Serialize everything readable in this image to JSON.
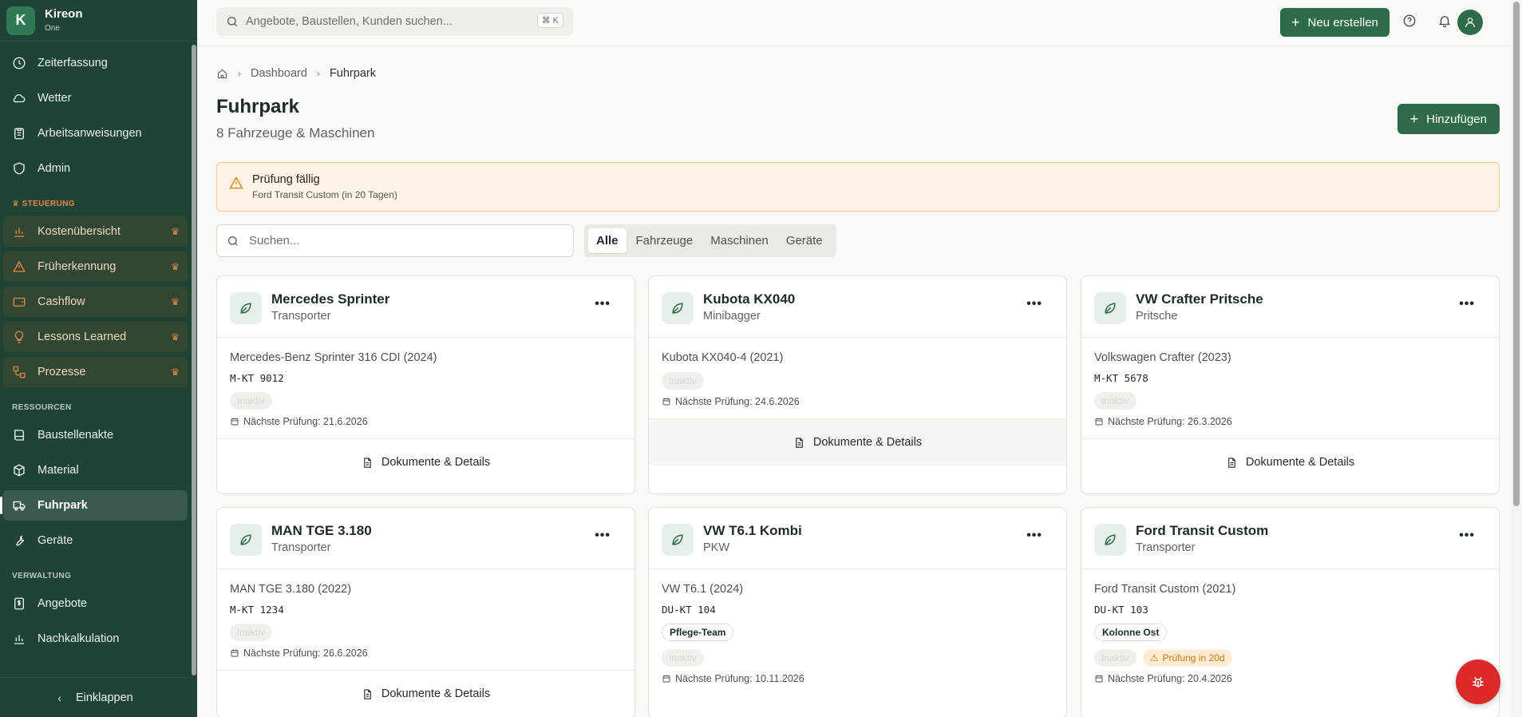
{
  "brand": {
    "initial": "K",
    "name": "Kireon",
    "sub": "One"
  },
  "sidebar": {
    "items_top": [
      {
        "label": "Zeiterfassung",
        "icon": "clock-icon"
      },
      {
        "label": "Wetter",
        "icon": "cloud-icon"
      },
      {
        "label": "Arbeitsanweisungen",
        "icon": "clipboard-icon"
      },
      {
        "label": "Admin",
        "icon": "shield-icon"
      }
    ],
    "section_steuerung": "STEUERUNG",
    "items_steuerung": [
      {
        "label": "Kostenübersicht",
        "icon": "bar-chart-icon"
      },
      {
        "label": "Früherkennung",
        "icon": "warning-icon"
      },
      {
        "label": "Cashflow",
        "icon": "wallet-icon"
      },
      {
        "label": "Lessons Learned",
        "icon": "lightbulb-icon"
      },
      {
        "label": "Prozesse",
        "icon": "workflow-icon"
      }
    ],
    "section_ressourcen": "RESSOURCEN",
    "items_ressourcen": [
      {
        "label": "Baustellenakte",
        "icon": "book-icon"
      },
      {
        "label": "Material",
        "icon": "package-icon"
      },
      {
        "label": "Fuhrpark",
        "icon": "truck-icon"
      },
      {
        "label": "Geräte",
        "icon": "wrench-icon"
      }
    ],
    "section_verwaltung": "VERWALTUNG",
    "items_verwaltung": [
      {
        "label": "Angebote",
        "icon": "dollar-doc-icon"
      },
      {
        "label": "Nachkalkulation",
        "icon": "bar-chart-icon"
      }
    ],
    "collapse_label": "Einklappen"
  },
  "topbar": {
    "search_placeholder": "Angebote, Baustellen, Kunden suchen...",
    "shortcut": "⌘ K",
    "new_label": "Neu erstellen"
  },
  "breadcrumb": {
    "parent": "Dashboard",
    "current": "Fuhrpark"
  },
  "page": {
    "title": "Fuhrpark",
    "subtitle": "8 Fahrzeuge & Maschinen",
    "add_label": "Hinzufügen"
  },
  "alert": {
    "title": "Prüfung fällig",
    "text": "Ford Transit Custom (in 20 Tagen)"
  },
  "filter": {
    "search_placeholder": "Suchen...",
    "tabs": [
      "Alle",
      "Fahrzeuge",
      "Maschinen",
      "Geräte"
    ],
    "active_tab": "Alle"
  },
  "cards": [
    {
      "title": "Mercedes Sprinter",
      "type": "Transporter",
      "model": "Mercedes-Benz Sprinter 316 CDI (2024)",
      "plate": "M-KT 9012",
      "team": "",
      "status": "Inaktiv",
      "due_badge": "",
      "next_check": "Nächste Prüfung: 21.6.2026",
      "footer": "Dokumente & Details"
    },
    {
      "title": "Kubota KX040",
      "type": "Minibagger",
      "model": "Kubota KX040-4 (2021)",
      "plate": "",
      "team": "",
      "status": "Inaktiv",
      "due_badge": "",
      "next_check": "Nächste Prüfung: 24.6.2026",
      "footer": "Dokumente & Details"
    },
    {
      "title": "VW Crafter Pritsche",
      "type": "Pritsche",
      "model": "Volkswagen Crafter (2023)",
      "plate": "M-KT 5678",
      "team": "",
      "status": "Inaktiv",
      "due_badge": "",
      "next_check": "Nächste Prüfung: 26.3.2026",
      "footer": "Dokumente & Details"
    },
    {
      "title": "MAN TGE 3.180",
      "type": "Transporter",
      "model": "MAN TGE 3.180 (2022)",
      "plate": "M-KT 1234",
      "team": "",
      "status": "Inaktiv",
      "due_badge": "",
      "next_check": "Nächste Prüfung: 26.6.2026",
      "footer": "Dokumente & Details"
    },
    {
      "title": "VW T6.1 Kombi",
      "type": "PKW",
      "model": "VW T6.1 (2024)",
      "plate": "DU-KT 104",
      "team": "Pflege-Team",
      "status": "Inaktiv",
      "due_badge": "",
      "next_check": "Nächste Prüfung: 10.11.2026",
      "footer": ""
    },
    {
      "title": "Ford Transit Custom",
      "type": "Transporter",
      "model": "Ford Transit Custom (2021)",
      "plate": "DU-KT 103",
      "team": "Kolonne Ost",
      "status": "Inaktiv",
      "due_badge": "Prüfung in 20d",
      "next_check": "Nächste Prüfung: 20.4.2026",
      "footer": ""
    }
  ],
  "colors": {
    "sidebar": "#1f4434",
    "primary": "#2e6b4b",
    "premium": "#e2884a",
    "warning": "#d98a12",
    "danger": "#dc2a2a"
  }
}
